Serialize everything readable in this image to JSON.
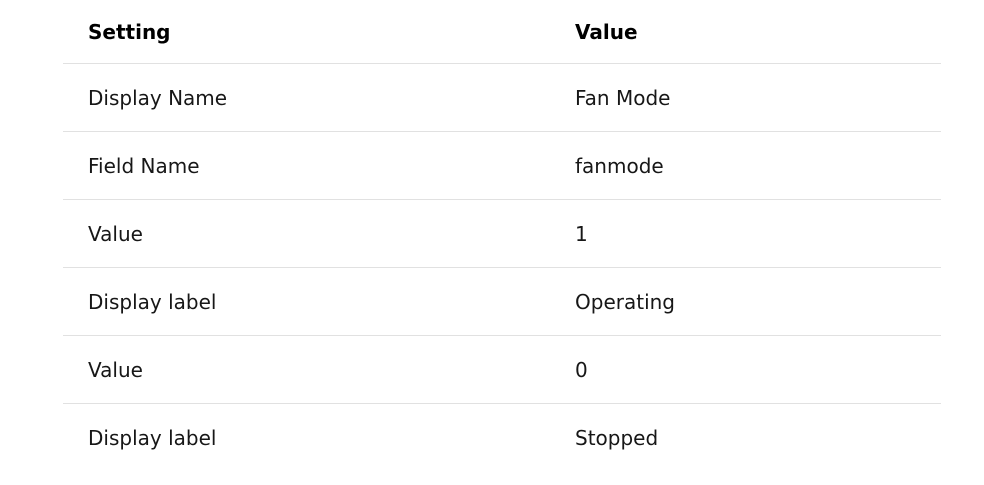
{
  "table": {
    "headers": {
      "setting": "Setting",
      "value": "Value"
    },
    "rows": [
      {
        "setting": "Display Name",
        "value": "Fan Mode"
      },
      {
        "setting": "Field Name",
        "value": "fanmode"
      },
      {
        "setting": "Value",
        "value": "1"
      },
      {
        "setting": "Display label",
        "value": "Operating"
      },
      {
        "setting": "Value",
        "value": "0"
      },
      {
        "setting": "Display label",
        "value": "Stopped"
      }
    ]
  }
}
